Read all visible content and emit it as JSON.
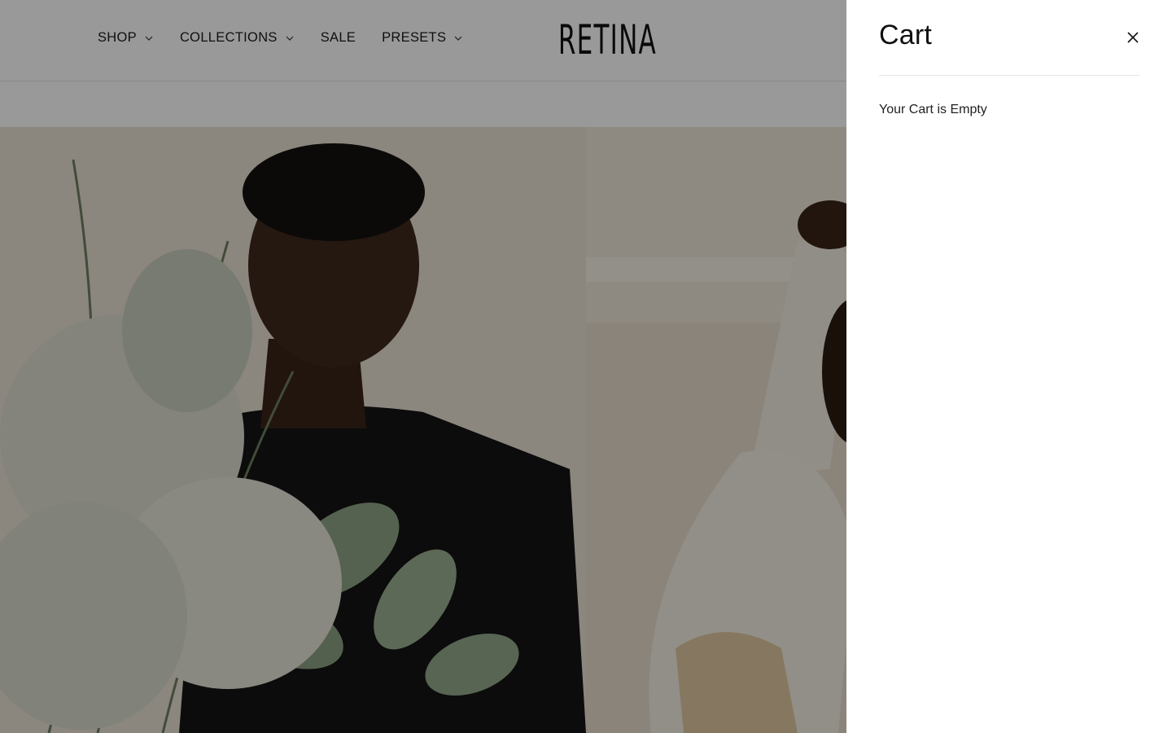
{
  "header": {
    "nav": [
      {
        "label": "SHOP",
        "has_dropdown": true,
        "icon": "chevron-down-icon"
      },
      {
        "label": "COLLECTIONS",
        "has_dropdown": true,
        "icon": "chevron-down-icon"
      },
      {
        "label": "SALE",
        "has_dropdown": false
      },
      {
        "label": "PRESETS",
        "has_dropdown": true,
        "icon": "chevron-down-icon"
      }
    ],
    "logo": "RETINA"
  },
  "hero": {
    "left_image": "woman-with-flowers-photo",
    "right_image": "woman-in-white-sweater-photo"
  },
  "cart": {
    "title": "Cart",
    "close_icon": "close-icon",
    "empty_message": "Your Cart is Empty"
  },
  "colors": {
    "overlay": "rgba(0,0,0,0.4)",
    "drawer_bg": "#ffffff",
    "text": "#111111"
  }
}
